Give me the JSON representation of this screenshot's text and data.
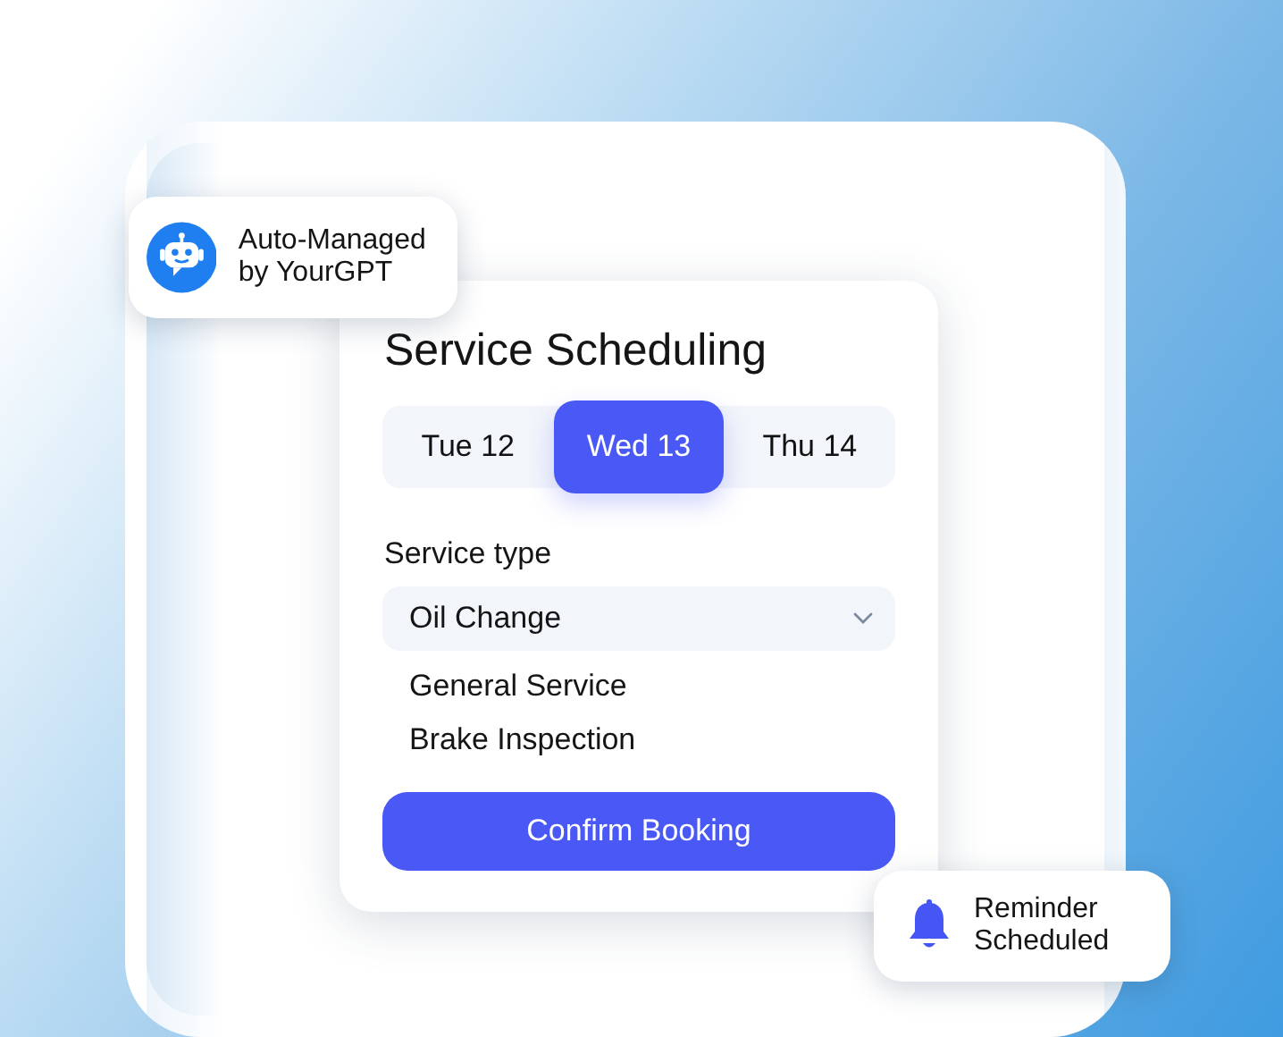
{
  "agent_badge": {
    "text": "Auto-Managed by YourGPT"
  },
  "card": {
    "title": "Service Scheduling",
    "dates": [
      {
        "label": "Tue 12",
        "selected": false
      },
      {
        "label": "Wed 13",
        "selected": true
      },
      {
        "label": "Thu 14",
        "selected": false
      }
    ],
    "service_type": {
      "label": "Service type",
      "value": "Oil Change",
      "options": [
        "General Service",
        "Brake Inspection"
      ]
    },
    "button": "Confirm Booking"
  },
  "reminder_badge": {
    "text": "Reminder Scheduled"
  }
}
